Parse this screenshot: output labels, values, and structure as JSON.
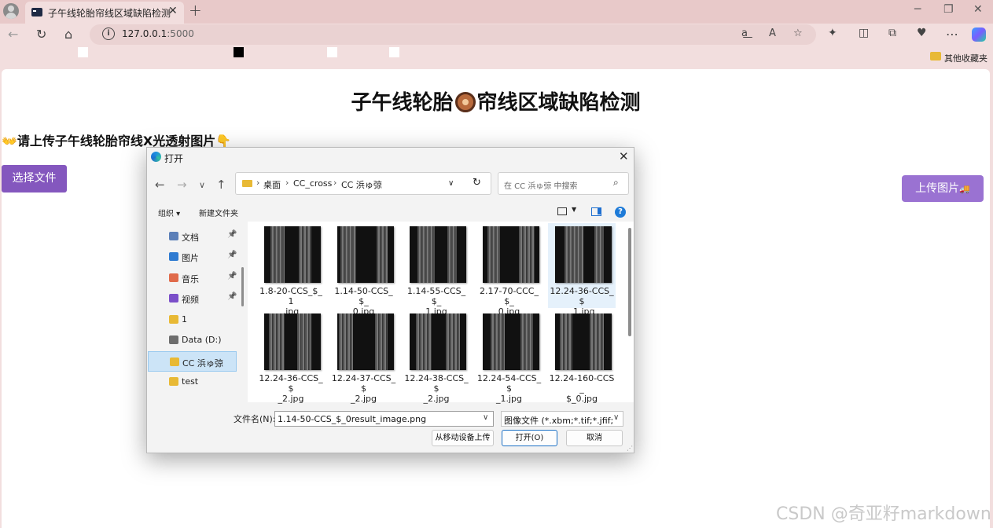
{
  "browser": {
    "tab_title": "子午线轮胎帘线区域缺陷检测",
    "tab_close": "✕",
    "new_tab": "+",
    "url_host": "127.0.0.1",
    "url_port": ":5000",
    "bookmarks_folder": "其他收藏夹",
    "window_minimize": "─",
    "window_restore": "❐",
    "window_close": "✕"
  },
  "page": {
    "title_left": "子午线轮胎",
    "title_right": "帘线区域缺陷检测",
    "instruction": "请上传子午线轮胎帘线X光透射图片",
    "choose_file_label": "选择文件",
    "upload_label": "上传图片",
    "watermark": "CSDN @奇亚籽markdown"
  },
  "dialog": {
    "title": "打开",
    "breadcrumbs": [
      "桌面",
      "CC_cross",
      "CC 浜ゅ弶"
    ],
    "search_placeholder": "在 CC 浜ゅ弶 中搜索",
    "organize_label": "组织 ▾",
    "new_folder_label": "新建文件夹",
    "help_label": "?",
    "sidebar": [
      {
        "label": "文档",
        "icon": "document-icon",
        "pinned": true,
        "color": "#5b7fb8"
      },
      {
        "label": "图片",
        "icon": "pictures-icon",
        "pinned": true,
        "color": "#2f7bd1"
      },
      {
        "label": "音乐",
        "icon": "music-icon",
        "pinned": true,
        "color": "#e06a4a"
      },
      {
        "label": "视频",
        "icon": "video-icon",
        "pinned": true,
        "color": "#7b4fc9"
      },
      {
        "label": "1",
        "icon": "folder-icon",
        "pinned": false,
        "color": "#e8b935"
      },
      {
        "label": "Data (D:)",
        "icon": "drive-icon",
        "pinned": false,
        "color": "#6d6d6d"
      },
      {
        "label": "CC 浜ゅ弶",
        "icon": "folder-icon",
        "pinned": false,
        "color": "#e8b935",
        "selected": true
      },
      {
        "label": "test",
        "icon": "folder-icon",
        "pinned": false,
        "color": "#e8b935"
      }
    ],
    "files": [
      {
        "line1": "1.8-20-CCS_$_1",
        "line2": ".jpg"
      },
      {
        "line1": "1.14-50-CCS_$_",
        "line2": "0.jpg"
      },
      {
        "line1": "1.14-55-CCS_$_",
        "line2": "1.jpg"
      },
      {
        "line1": "2.17-70-CCC_$_",
        "line2": "0.jpg"
      },
      {
        "line1": "12.24-36-CCS_$",
        "line2": "_1.jpg",
        "selected": true
      },
      {
        "line1": "12.24-36-CCS_$",
        "line2": "_2.jpg"
      },
      {
        "line1": "12.24-37-CCS_$",
        "line2": "_2.jpg"
      },
      {
        "line1": "12.24-38-CCS_$",
        "line2": "_2.jpg"
      },
      {
        "line1": "12.24-54-CCS_$",
        "line2": "_1.jpg"
      },
      {
        "line1": "12.24-160-CCS_",
        "line2": "$_0.jpg"
      }
    ],
    "filename_label": "文件名(N):",
    "filename_value": "1.14-50-CCS_$_0result_image.png",
    "filetype_value": "图像文件 (*.xbm;*.tif;*.jfif;*.ico",
    "upload_from_mobile_label": "从移动设备上传",
    "open_label": "打开(O)",
    "cancel_label": "取消"
  }
}
